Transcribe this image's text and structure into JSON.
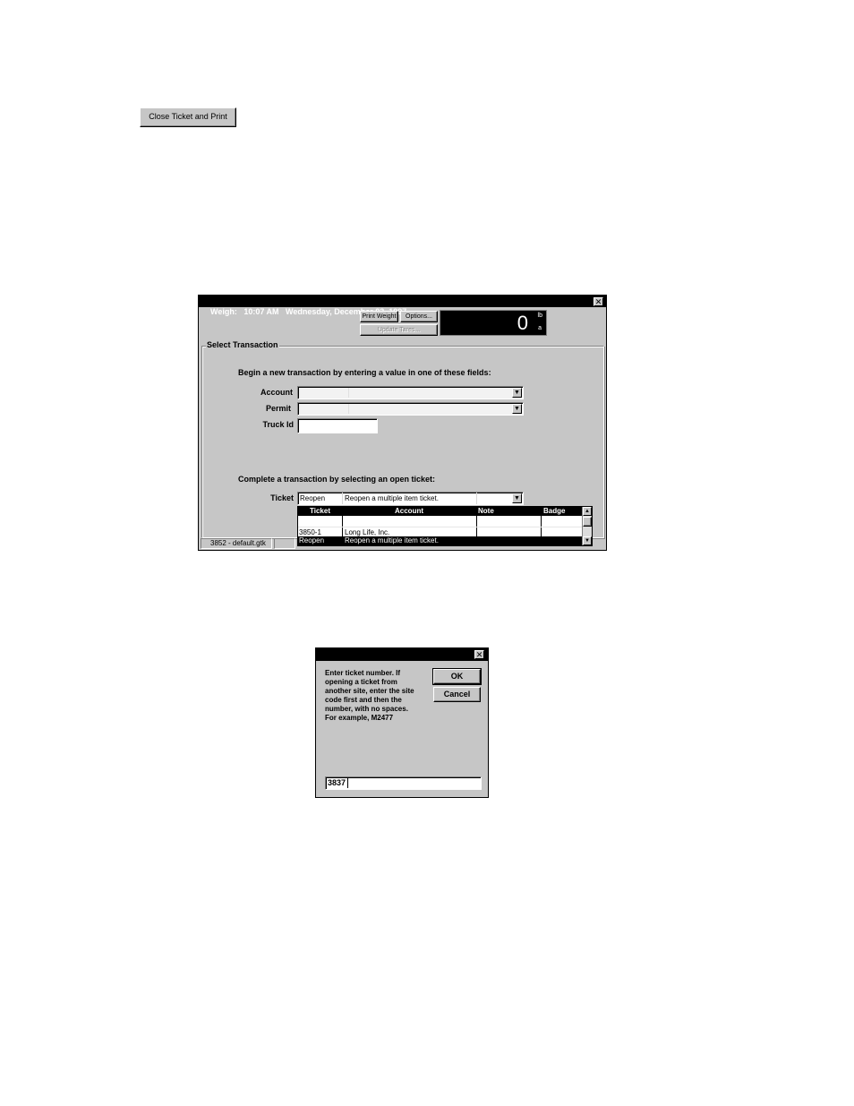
{
  "top_button": {
    "label": "Close Ticket and Print"
  },
  "weigh_window": {
    "title": "Weigh:   10:07 AM   Wednesday, December 03, 1997",
    "close_glyph": "✕",
    "buttons": {
      "print_weight": "Print Weight",
      "options": "Options...",
      "update_tares": "Update Tares..."
    },
    "scale": {
      "value": "0",
      "unit": "lb",
      "indicator": "a"
    },
    "group_title": "Select Transaction",
    "new_txn_instruction": "Begin a new transaction by entering a value in one of these fields:",
    "fields": {
      "account_label": "Account",
      "permit_label": "Permit",
      "truck_label": "Truck Id"
    },
    "complete_instruction": "Complete a transaction by selecting an open ticket:",
    "ticket_label": "Ticket",
    "ticket_value": {
      "ticket": "Reopen",
      "account": "Reopen a multiple item ticket."
    },
    "dropdown_glyph": "▼",
    "list": {
      "columns": [
        "Ticket",
        "Account",
        "Note",
        "Badge"
      ],
      "rows": [
        {
          "ticket": "",
          "account": "",
          "note": "",
          "badge": ""
        },
        {
          "ticket": "3850-1",
          "account": "Long Life, Inc.",
          "note": "",
          "badge": ""
        },
        {
          "ticket": "Reopen",
          "account": "Reopen a multiple item ticket.",
          "note": "",
          "badge": ""
        }
      ],
      "scroll_up_glyph": "▲",
      "scroll_down_glyph": "▼"
    },
    "status": {
      "left": "3852 - default.gtk"
    }
  },
  "ticket_dialog": {
    "title": "",
    "close_glyph": "✕",
    "message": "Enter ticket number.  If opening a ticket from another site, enter the site code first and then the number, with no spaces.  For example, M2477",
    "ok_label": "OK",
    "cancel_label": "Cancel",
    "input_value": "3837"
  }
}
